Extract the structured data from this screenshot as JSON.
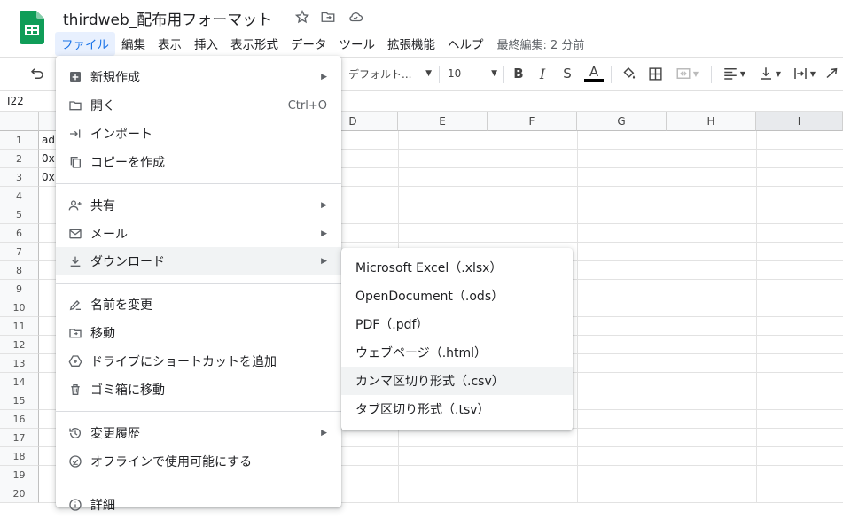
{
  "doc": {
    "title": "thirdweb_配布用フォーマット",
    "last_edit": "最終編集: 2 分前"
  },
  "menubar": [
    {
      "label": "ファイル",
      "name": "menu-file",
      "active": true
    },
    {
      "label": "編集",
      "name": "menu-edit"
    },
    {
      "label": "表示",
      "name": "menu-view"
    },
    {
      "label": "挿入",
      "name": "menu-insert"
    },
    {
      "label": "表示形式",
      "name": "menu-format"
    },
    {
      "label": "データ",
      "name": "menu-data"
    },
    {
      "label": "ツール",
      "name": "menu-tools"
    },
    {
      "label": "拡張機能",
      "name": "menu-extensions"
    },
    {
      "label": "ヘルプ",
      "name": "menu-help"
    }
  ],
  "toolbar": {
    "font_name": "デフォルト...",
    "font_size": "10",
    "text_color": "#000000"
  },
  "formula_bar": {
    "name_box": "I22"
  },
  "grid": {
    "columns": [
      "D",
      "E",
      "F",
      "G",
      "H",
      "I"
    ],
    "rows": [
      "1",
      "2",
      "3",
      "4",
      "5",
      "6",
      "7",
      "8",
      "9",
      "10",
      "11",
      "12",
      "13",
      "14",
      "15",
      "16",
      "17",
      "18",
      "19",
      "20"
    ],
    "cells": [
      {
        "row": 1,
        "text": "ad"
      },
      {
        "row": 2,
        "text": "0x"
      },
      {
        "row": 3,
        "text": "0x"
      }
    ]
  },
  "file_menu": {
    "items": [
      {
        "label": "新規作成",
        "icon": "plus-box-icon",
        "submenu": true
      },
      {
        "label": "開く",
        "icon": "folder-icon",
        "shortcut": "Ctrl+O"
      },
      {
        "label": "インポート",
        "icon": "import-arrow-icon"
      },
      {
        "label": "コピーを作成",
        "icon": "copy-icon"
      },
      {
        "label": "共有",
        "icon": "person-add-icon",
        "submenu": true
      },
      {
        "label": "メール",
        "icon": "mail-icon",
        "submenu": true
      },
      {
        "label": "ダウンロード",
        "icon": "download-icon",
        "submenu": true,
        "hover": true
      },
      {
        "label": "名前を変更",
        "icon": "rename-pencil-icon"
      },
      {
        "label": "移動",
        "icon": "move-folder-icon"
      },
      {
        "label": "ドライブにショートカットを追加",
        "icon": "drive-shortcut-icon"
      },
      {
        "label": "ゴミ箱に移動",
        "icon": "trash-icon"
      },
      {
        "label": "変更履歴",
        "icon": "history-icon",
        "submenu": true
      },
      {
        "label": "オフラインで使用可能にする",
        "icon": "offline-check-icon"
      },
      {
        "label": "詳細",
        "icon": "info-icon"
      }
    ]
  },
  "download_menu": {
    "items": [
      {
        "label": "Microsoft Excel（.xlsx）"
      },
      {
        "label": "OpenDocument（.ods）"
      },
      {
        "label": "PDF（.pdf）"
      },
      {
        "label": "ウェブページ（.html）"
      },
      {
        "label": "カンマ区切り形式（.csv）",
        "hover": true
      },
      {
        "label": "タブ区切り形式（.tsv）"
      }
    ]
  },
  "colors": {
    "sheets_green": "#0f9d58",
    "active_menu_bg": "#e8f0fe",
    "active_menu_text": "#1a73e8",
    "hover_bg": "#f1f3f4"
  }
}
